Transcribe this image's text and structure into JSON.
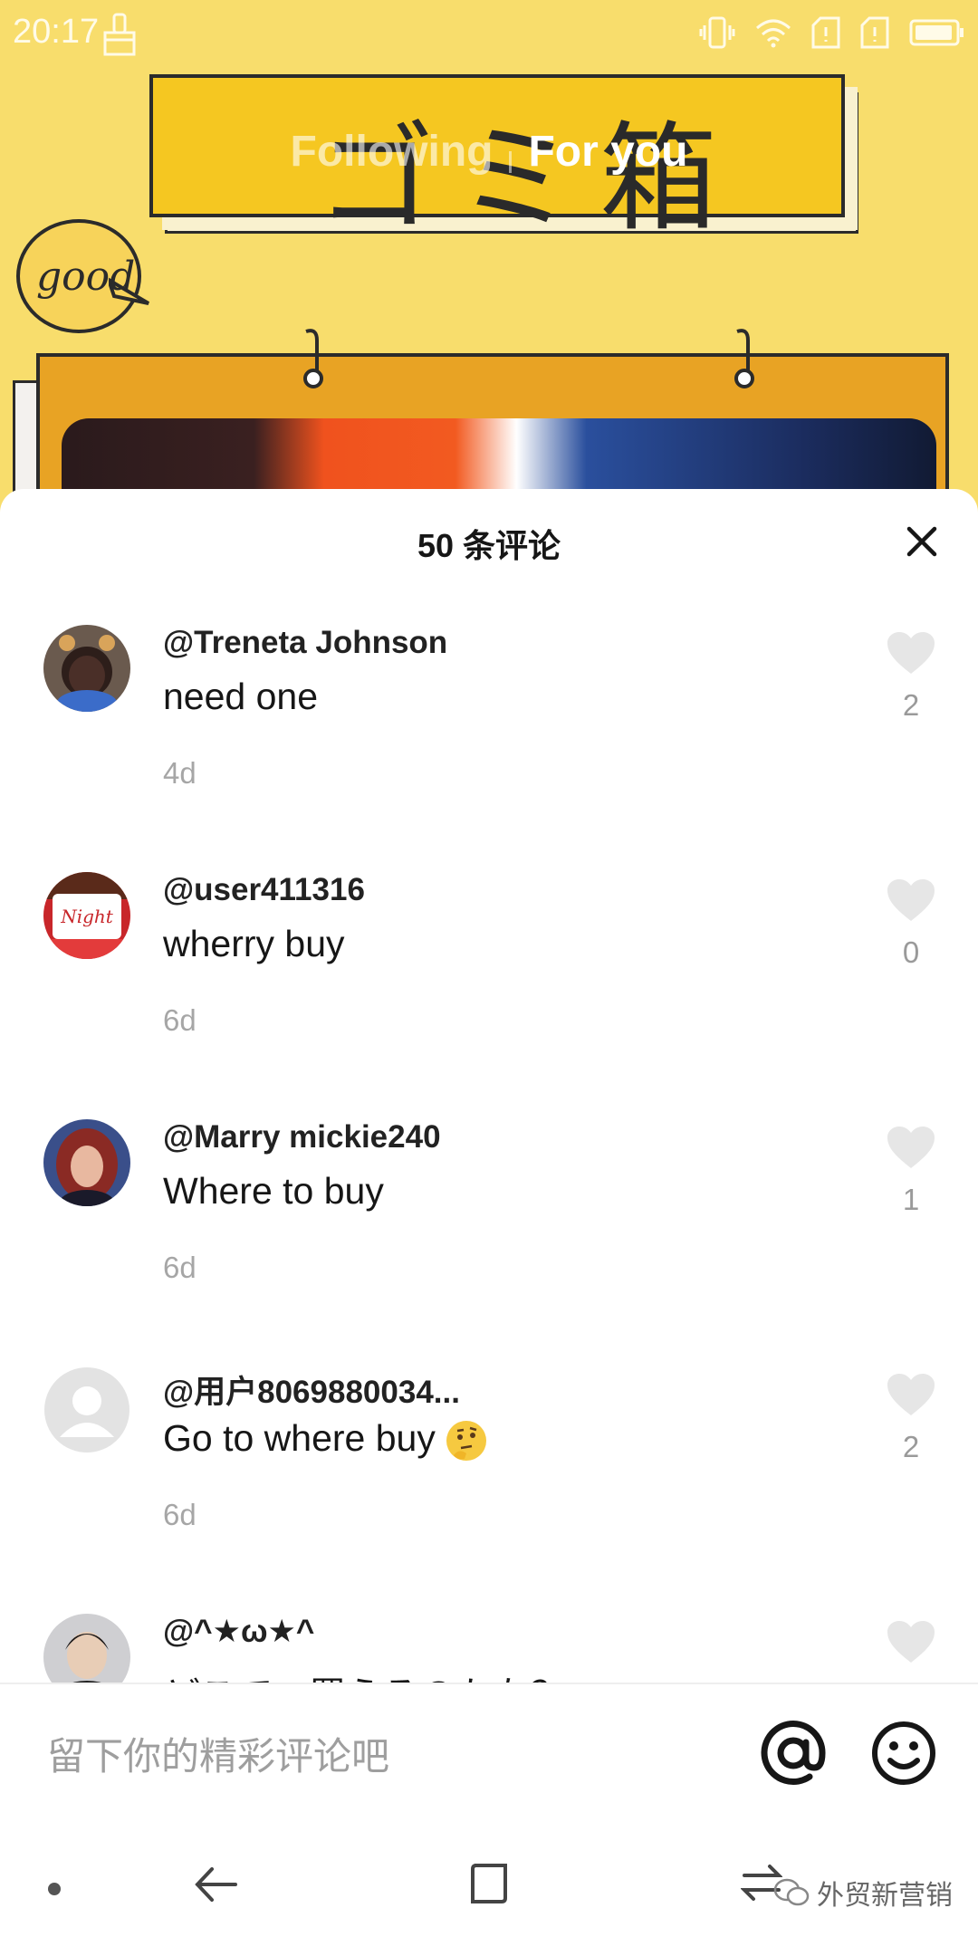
{
  "status_bar": {
    "time": "20:17"
  },
  "video": {
    "title_text": "ゴミ箱",
    "bubble_text": "good",
    "tabs": {
      "following": "Following",
      "for_you": "For you"
    }
  },
  "comments_sheet": {
    "header": {
      "count_label": "50 条评论"
    },
    "comments": [
      {
        "user": "@Treneta Johnson",
        "text": "need one",
        "time": "4d",
        "likes": "2"
      },
      {
        "user": "@user411316",
        "text": "wherry buy",
        "time": "6d",
        "likes": "0",
        "avatar_text": "Night"
      },
      {
        "user": "@Marry mickie240",
        "text": "Where to buy",
        "time": "6d",
        "likes": "1"
      },
      {
        "user": "@用户8069880034...",
        "text": "Go to where buy",
        "time": "6d",
        "likes": "2"
      },
      {
        "user": "@^★ω★^",
        "text": "どこで、買えるのかな？",
        "time": "",
        "likes": ""
      }
    ],
    "input": {
      "placeholder": "留下你的精彩评论吧",
      "value": ""
    }
  },
  "nav_bar": {
    "watermark": "外贸新营销"
  },
  "colors": {
    "video_background": "#f8dd6c",
    "title_board": "#f5c721",
    "frame": "#e8a324",
    "like_icon": "#e6e6e6",
    "secondary_text": "#a6a6a6"
  },
  "icons": {
    "close": "close-icon",
    "like": "heart-icon",
    "mention": "at-sign-icon",
    "emoji": "smiley-icon",
    "back": "back-arrow-icon",
    "home": "square-home-icon",
    "switch": "switch-arrows-icon",
    "menu": "menu-icon"
  }
}
